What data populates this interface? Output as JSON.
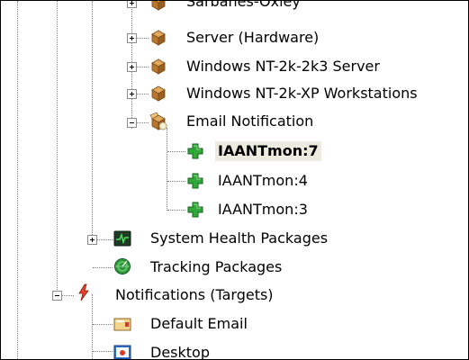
{
  "tree": {
    "items": [
      {
        "label": "Sarbanes-Oxley",
        "icon": "package-box-icon",
        "expanded": false
      },
      {
        "label": "Server (Hardware)",
        "icon": "package-box-icon",
        "expanded": false
      },
      {
        "label": "Windows NT-2k-2k3 Server",
        "icon": "package-box-icon",
        "expanded": false
      },
      {
        "label": "Windows NT-2k-XP Workstations",
        "icon": "package-box-icon",
        "expanded": false
      },
      {
        "label": "Email Notification",
        "icon": "open-package-icon",
        "expanded": true
      },
      {
        "label": "IAANTmon:7",
        "icon": "green-plus-icon",
        "selected": true
      },
      {
        "label": "IAANTmon:4",
        "icon": "green-plus-icon"
      },
      {
        "label": "IAANTmon:3",
        "icon": "green-plus-icon"
      },
      {
        "label": "System Health Packages",
        "icon": "health-monitor-icon",
        "expanded": false
      },
      {
        "label": "Tracking Packages",
        "icon": "tracking-radar-icon"
      },
      {
        "label": "Notifications (Targets)",
        "icon": "notification-lightning-icon",
        "expanded": true
      },
      {
        "label": "Default Email",
        "icon": "email-target-icon"
      },
      {
        "label": "Desktop",
        "icon": "desktop-target-icon"
      }
    ]
  },
  "colors": {
    "selection_bg": "#ecebdf",
    "package_brown": "#c8893f",
    "plus_green": "#2fa838"
  }
}
